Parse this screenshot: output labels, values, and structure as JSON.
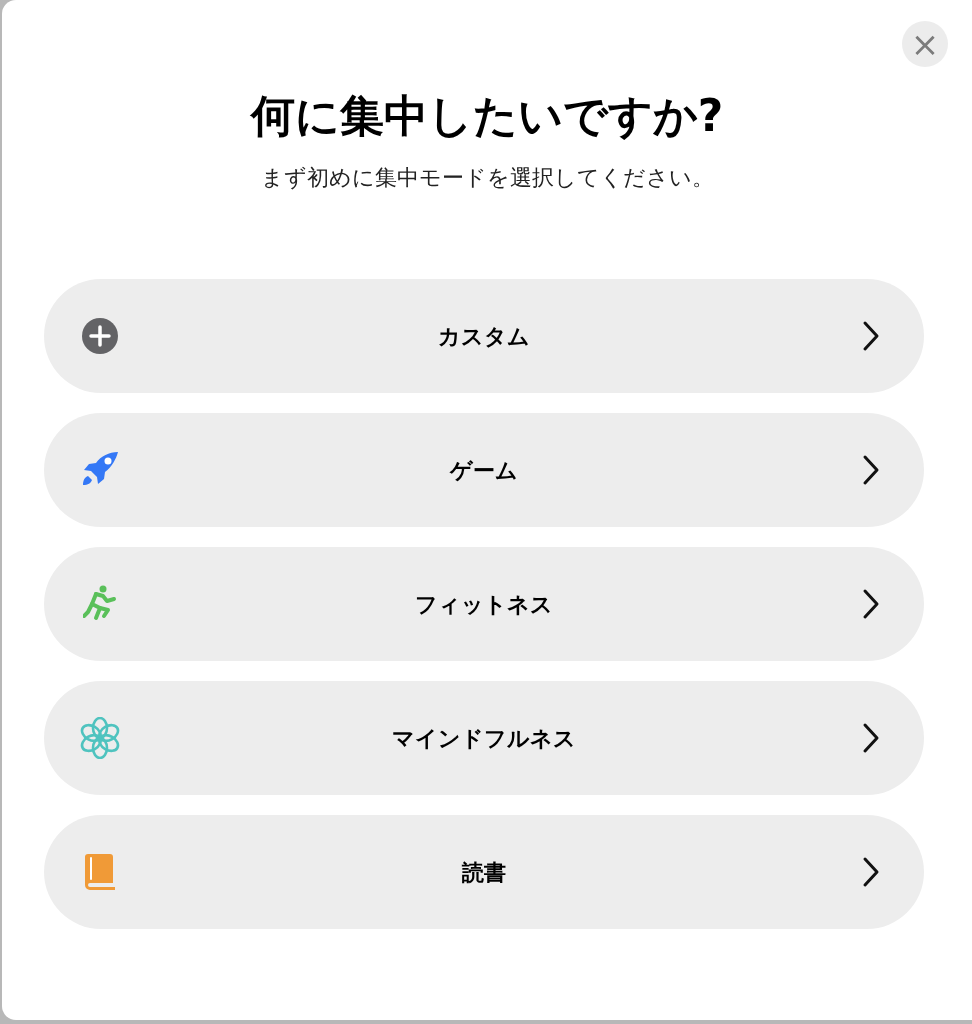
{
  "close_button": {
    "label": "×"
  },
  "title": "何に集中したいですか?",
  "subtitle": "まず初めに集中モードを選択してください。",
  "modes": [
    {
      "label": "カスタム",
      "kind": "plus",
      "color": "#636366"
    },
    {
      "label": "ゲーム",
      "kind": "rocket",
      "color": "#3478f6"
    },
    {
      "label": "フィットネス",
      "kind": "runner",
      "color": "#5ac05a"
    },
    {
      "label": "マインドフルネス",
      "kind": "flower",
      "color": "#4fc3bf"
    },
    {
      "label": "読書",
      "kind": "book",
      "color": "#f09a37"
    }
  ]
}
